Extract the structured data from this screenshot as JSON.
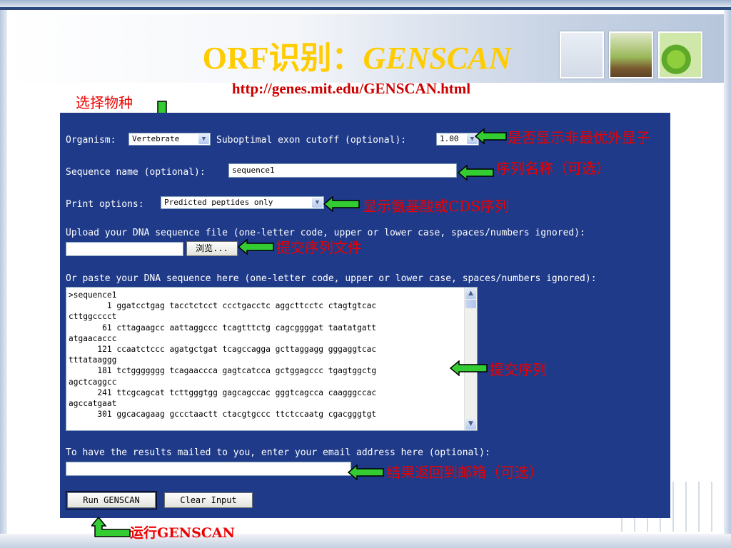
{
  "slide": {
    "title_prefix": "ORF识别：",
    "title_italic": "GENSCAN",
    "url": "http://genes.mit.edu/GENSCAN.html"
  },
  "annotations": {
    "select_species": "选择物种",
    "suboptimal": "是否显示非最优外显子",
    "sequence_name": "序列名称（可选）",
    "print_options": "显示氨基酸或CDS序列",
    "upload_file": "提交序列文件",
    "submit_sequence": "提交序列",
    "email": "结果返回到邮箱（可选）",
    "run": "运行GENSCAN"
  },
  "form": {
    "organism_label": "Organism:",
    "organism_value": "Vertebrate",
    "suboptimal_label": "Suboptimal exon cutoff (optional):",
    "suboptimal_value": "1.00",
    "sequence_name_label": "Sequence name (optional):",
    "sequence_name_value": "sequence1",
    "print_options_label": "Print options:",
    "print_options_value": "Predicted peptides only",
    "upload_label": "Upload your DNA sequence file (one-letter code, upper or lower case, spaces/numbers ignored):",
    "browse_label": "浏览...",
    "paste_label": "Or paste your DNA sequence here (one-letter code, upper or lower case, spaces/numbers ignored):",
    "sequence_text": ">sequence1\n        1 ggatcctgag tacctctcct ccctgacctc aggcttcctc ctagtgtcac\ncttggcccct\n       61 cttagaagcc aattaggccc tcagtttctg cagcggggat taatatgatt\natgaacaccc\n      121 ccaatctccc agatgctgat tcagccagga gcttaggagg gggaggtcac\ntttataaggg\n      181 tctggggggg tcagaaccca gagtcatcca gctggagccc tgagtggctg\nagctcaggcc\n      241 ttcgcagcat tcttgggtgg gagcagccac gggtcagcca caagggccac\nagccatgaat\n      301 ggcacagaag gccctaactt ctacgtgccc ttctccaatg cgacgggtgt",
    "email_label": "To have the results mailed to you, enter your email address here (optional):",
    "email_value": "",
    "run_button": "Run GENSCAN",
    "clear_button": "Clear Input"
  },
  "colors": {
    "panel": "#1f3a88",
    "title": "#ffcc00",
    "annotation": "#ee0000",
    "arrow": "#33cc33"
  }
}
